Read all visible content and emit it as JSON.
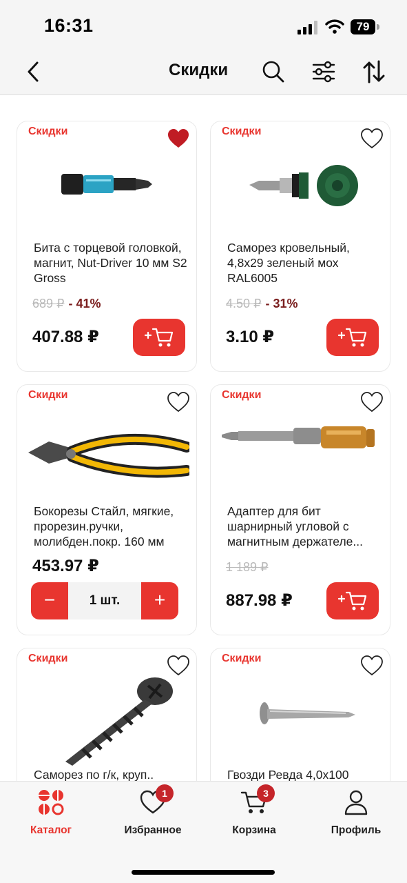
{
  "status_bar": {
    "time": "16:31",
    "battery": "79"
  },
  "nav": {
    "title": "Скидки",
    "back_icon": "chevron-left-icon",
    "search_icon": "search-icon",
    "filter_icon": "sliders-icon",
    "sort_icon": "sort-arrows-icon"
  },
  "colors": {
    "accent": "#e8352f",
    "discount_text": "#7a1d1d",
    "badge_count": "#c5252a"
  },
  "products": [
    {
      "badge": "Скидки",
      "name": "Бита с торцевой головкой, магнит, Nut-Driver 10 мм S2 Gross",
      "old_price": "689 ₽",
      "discount": "- 41%",
      "price": "407.88 ₽",
      "favorite": true,
      "action": "add-to-cart"
    },
    {
      "badge": "Скидки",
      "name": "Саморез кровельный, 4,8х29 зеленый мох RAL6005",
      "old_price": "4.50 ₽",
      "discount": "- 31%",
      "price": "3.10 ₽",
      "favorite": false,
      "action": "add-to-cart"
    },
    {
      "badge": "Скидки",
      "name": "Бокорезы Стайл, мягкие, прорезин.ручки, молибден.покр. 160 мм",
      "old_price": "",
      "discount": "",
      "price": "453.97 ₽",
      "favorite": false,
      "action": "stepper",
      "quantity": "1 шт.",
      "minus": "−",
      "plus": "+"
    },
    {
      "badge": "Скидки",
      "name": "Адаптер для бит шарнирный угловой с магнитным держателе...",
      "old_price": "1 189 ₽",
      "discount": "",
      "price": "887.98 ₽",
      "favorite": false,
      "action": "add-to-cart"
    },
    {
      "badge": "Скидки",
      "name": "Саморез по г/к, круп..",
      "favorite": false
    },
    {
      "badge": "Скидки",
      "name": "Гвозди Ревда 4,0х100",
      "favorite": false
    }
  ],
  "tab_bar": [
    {
      "label": "Каталог",
      "icon": "catalog-icon",
      "active": true
    },
    {
      "label": "Избранное",
      "icon": "heart-icon",
      "count": "1"
    },
    {
      "label": "Корзина",
      "icon": "cart-icon",
      "count": "3"
    },
    {
      "label": "Профиль",
      "icon": "profile-icon"
    }
  ]
}
